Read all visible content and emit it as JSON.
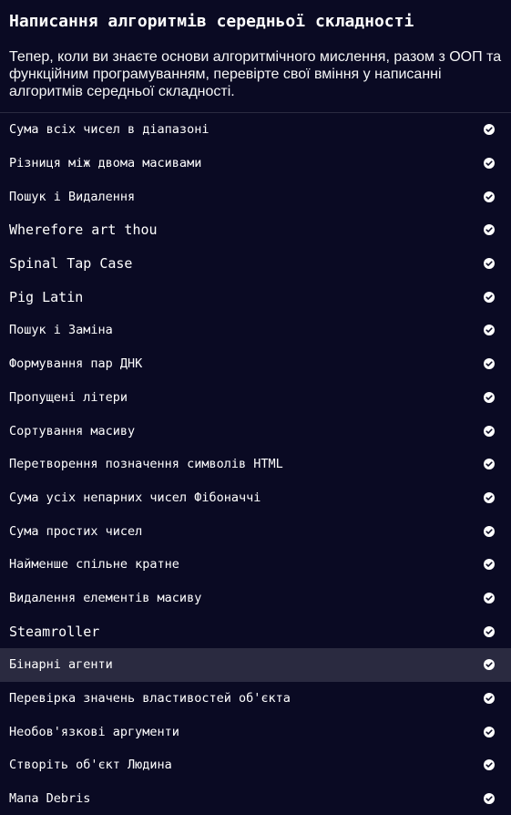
{
  "block": {
    "title": "Написання алгоритмів середньої складності",
    "description": "Тепер, коли ви знаєте основи алгоритмічного мислення, разом з ООП та функційним програмуванням, перевірте свої вміння у написанні алгоритмів середньої складності."
  },
  "challenges": [
    {
      "label": "Сума всіх чисел в діапазоні",
      "completed": true
    },
    {
      "label": "Різниця між двома масивами",
      "completed": true
    },
    {
      "label": "Пошук і Видалення",
      "completed": true
    },
    {
      "label": "Wherefore art thou",
      "completed": true
    },
    {
      "label": "Spinal Tap Case",
      "completed": true
    },
    {
      "label": "Pig Latin",
      "completed": true
    },
    {
      "label": "Пошук і Заміна",
      "completed": true
    },
    {
      "label": "Формування пар ДНК",
      "completed": true
    },
    {
      "label": "Пропущені літери",
      "completed": true
    },
    {
      "label": "Сортування масиву",
      "completed": true
    },
    {
      "label": "Перетворення позначення символів HTML",
      "completed": true
    },
    {
      "label": "Сума усіх непарних чисел Фібоначчі",
      "completed": true
    },
    {
      "label": "Сума простих чисел",
      "completed": true
    },
    {
      "label": "Найменше спільне кратне",
      "completed": true
    },
    {
      "label": "Видалення елементів масиву",
      "completed": true
    },
    {
      "label": "Steamroller",
      "completed": true
    },
    {
      "label": "Бінарні агенти",
      "completed": true,
      "active": true
    },
    {
      "label": "Перевірка значень властивостей об'єкта",
      "completed": true
    },
    {
      "label": "Необов'язкові аргументи",
      "completed": true
    },
    {
      "label": "Створіть об'єкт Людина",
      "completed": true
    },
    {
      "label": "Мапа Debris",
      "completed": true
    }
  ],
  "colors": {
    "background": "#0a0a23",
    "active_row": "#2a2a40",
    "check": "#ffffff"
  },
  "icons": {
    "completed": "check-circle-icon"
  }
}
